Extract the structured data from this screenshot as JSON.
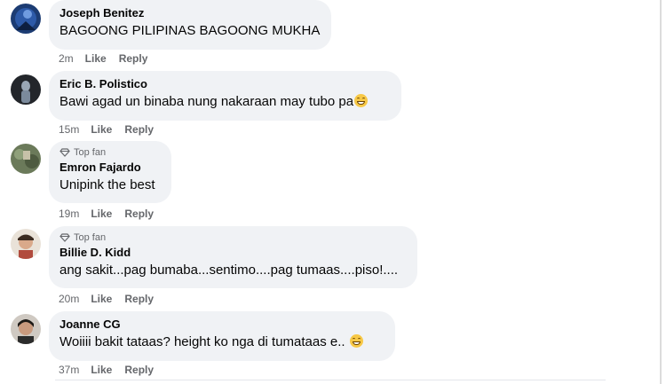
{
  "comments": [
    {
      "name": "Joseph Benitez",
      "top_fan": "",
      "text": "BAGOONG PILIPINAS BAGOONG MUKHA",
      "emoji": "",
      "time": "2m",
      "like": "Like",
      "reply": "Reply"
    },
    {
      "name": "Eric B. Polistico",
      "top_fan": "",
      "text": "Bawi agad un binaba nung nakaraan may tubo pa",
      "emoji": "grinning-face-emoji",
      "time": "15m",
      "like": "Like",
      "reply": "Reply"
    },
    {
      "name": "Emron Fajardo",
      "top_fan": "Top fan",
      "text": "Unipink the best",
      "emoji": "",
      "time": "19m",
      "like": "Like",
      "reply": "Reply"
    },
    {
      "name": "Billie D. Kidd",
      "top_fan": "Top fan",
      "text": "ang sakit...pag bumaba...sentimo....pag tumaas....piso!....",
      "emoji": "",
      "time": "20m",
      "like": "Like",
      "reply": "Reply"
    },
    {
      "name": "Joanne CG",
      "top_fan": "",
      "text": "Woiiii bakit tataas? height ko nga di tumataas e..",
      "emoji": "grinning-face-emoji",
      "time": "37m",
      "like": "Like",
      "reply": "Reply"
    }
  ],
  "colors": {
    "bubble": "#f0f2f5",
    "secondary_text": "#65676b",
    "primary_text": "#050505"
  }
}
